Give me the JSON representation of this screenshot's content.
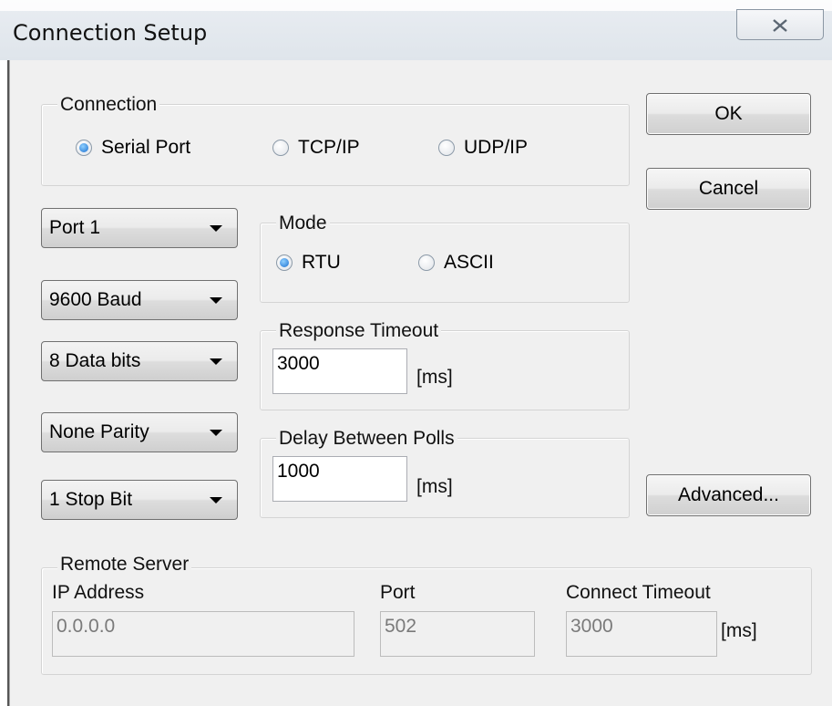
{
  "window": {
    "title": "Connection Setup",
    "close_icon": "close-icon"
  },
  "connection": {
    "label": "Connection",
    "options": [
      "Serial Port",
      "TCP/IP",
      "UDP/IP"
    ],
    "selected": "Serial Port"
  },
  "buttons": {
    "ok": "OK",
    "cancel": "Cancel",
    "advanced": "Advanced..."
  },
  "serial": {
    "port": "Port 1",
    "baud": "9600 Baud",
    "data_bits": "8 Data bits",
    "parity": "None Parity",
    "stop_bits": "1 Stop Bit"
  },
  "mode": {
    "label": "Mode",
    "options": [
      "RTU",
      "ASCII"
    ],
    "selected": "RTU"
  },
  "response_timeout": {
    "label": "Response Timeout",
    "value": "3000",
    "unit": "[ms]"
  },
  "delay_between_polls": {
    "label": "Delay Between Polls",
    "value": "1000",
    "unit": "[ms]"
  },
  "remote_server": {
    "label": "Remote Server",
    "ip_label": "IP Address",
    "ip_value": "0.0.0.0",
    "port_label": "Port",
    "port_value": "502",
    "timeout_label": "Connect Timeout",
    "timeout_value": "3000",
    "timeout_unit": "[ms]"
  },
  "colors": {
    "radio_selected": "#1a6fcf",
    "client_bg": "#f0f0f0"
  }
}
